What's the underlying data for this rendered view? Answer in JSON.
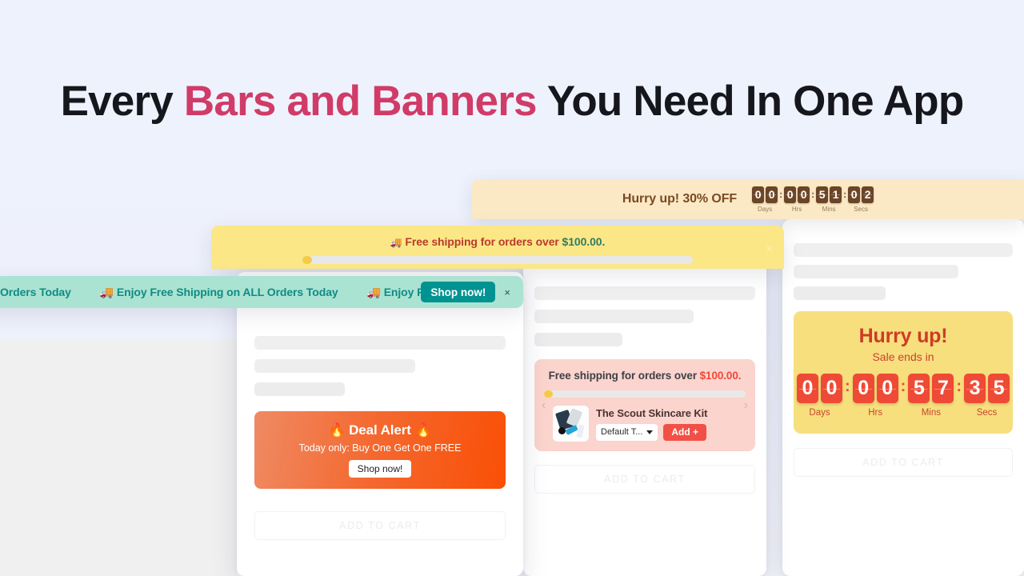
{
  "headline": {
    "part1": "Every ",
    "accent": "Bars and Banners",
    "part2": " You Need In One App"
  },
  "cream_bar": {
    "message": "Hurry up! 30% OFF",
    "countdown": {
      "days": "00",
      "hours": "00",
      "minutes": "51",
      "seconds": "02",
      "labels": {
        "days": "Days",
        "hours": "Hrs",
        "minutes": "Mins",
        "seconds": "Secs"
      },
      "separator": ":"
    }
  },
  "yellow_bar": {
    "icon": "truck-icon",
    "text": "Free shipping for orders over ",
    "amount": "$100.00.",
    "close_label": "×",
    "progress_percent": 1
  },
  "teal_bar": {
    "messages": [
      "Orders Today",
      "🚚 Enjoy Free Shipping on ALL Orders Today",
      "🚚 Enjoy Free S"
    ],
    "cta_label": "Shop now!",
    "close_label": "×"
  },
  "left_card": {
    "deal": {
      "title": "🔥 Deal Alert 🔥",
      "subtitle": "Today only: Buy One Get One FREE",
      "button_label": "Shop now!"
    },
    "add_to_cart_label": "ADD TO CART"
  },
  "mid_card": {
    "shipping": {
      "text": "Free shipping for orders over ",
      "amount": "$100.00.",
      "progress_percent": 1,
      "prev_label": "‹",
      "next_label": "›",
      "product": {
        "name": "The Scout Skincare Kit",
        "variant": "Default T...",
        "add_label": "Add +"
      }
    },
    "add_to_cart_label": "ADD TO CART"
  },
  "right_card": {
    "hurry": {
      "title": "Hurry up!",
      "subtitle": "Sale ends in",
      "countdown": {
        "days": "00",
        "hours": "00",
        "minutes": "57",
        "seconds": "35",
        "labels": {
          "days": "Days",
          "hours": "Hrs",
          "minutes": "Mins",
          "seconds": "Secs"
        },
        "separator": ":"
      }
    },
    "add_to_cart_label": "ADD TO CART"
  },
  "colors": {
    "page_bg": "#eef1fb",
    "accent_pink": "#d03b68",
    "cream": "#fbe9c6",
    "yellow": "#fce787",
    "teal": "#abe3d2",
    "teal_text": "#0f8c84",
    "orange": "#f4682f",
    "red": "#ef4a35",
    "pink_card": "#fad4cd"
  }
}
